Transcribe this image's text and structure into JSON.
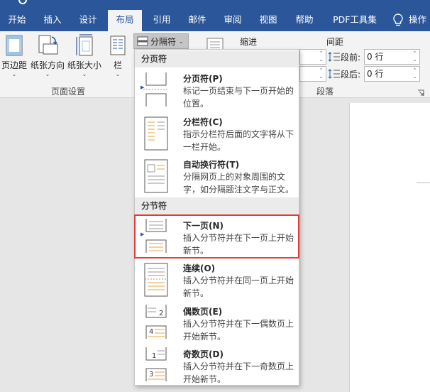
{
  "ribbon_tabs": [
    {
      "label": "开始"
    },
    {
      "label": "插入"
    },
    {
      "label": "设计"
    },
    {
      "label": "布局"
    },
    {
      "label": "引用"
    },
    {
      "label": "邮件"
    },
    {
      "label": "审阅"
    },
    {
      "label": "视图"
    },
    {
      "label": "帮助"
    },
    {
      "label": "PDF工具集"
    },
    {
      "label": "操作"
    }
  ],
  "active_tab": "布局",
  "page_setup": {
    "margins_label": "页边距",
    "orientation_label": "纸张方向",
    "size_label": "纸张大小",
    "columns_label": "栏",
    "group_label": "页面设置"
  },
  "breaks_button": {
    "label": "分隔符"
  },
  "paragraph": {
    "indent_label": "缩进",
    "spacing_label": "间距",
    "before_label": "段前:",
    "before_value": "0 行",
    "after_label": "段后:",
    "after_value": "0 行",
    "group_label": "段落"
  },
  "menu": {
    "page_breaks_header": "分页符",
    "section_breaks_header": "分节符",
    "items": [
      {
        "title": "分页符(P)",
        "desc": "标记一页结束与下一页开始的位置。"
      },
      {
        "title": "分栏符(C)",
        "desc": "指示分栏符后面的文字将从下一栏开始。"
      },
      {
        "title": "自动换行符(T)",
        "desc": "分隔网页上的对象周围的文字，如分隔题注文字与正文。"
      },
      {
        "title": "下一页(N)",
        "desc": "插入分节符并在下一页上开始新节。"
      },
      {
        "title": "连续(O)",
        "desc": "插入分节符并在同一页上开始新节。"
      },
      {
        "title": "偶数页(E)",
        "desc": "插入分节符并在下一偶数页上开始新节。"
      },
      {
        "title": "奇数页(D)",
        "desc": "插入分节符并在下一奇数页上开始新节。"
      }
    ],
    "highlighted_item": "下一页(N)"
  },
  "colors": {
    "accent": "#2b579a",
    "highlight_border": "#e53935"
  }
}
